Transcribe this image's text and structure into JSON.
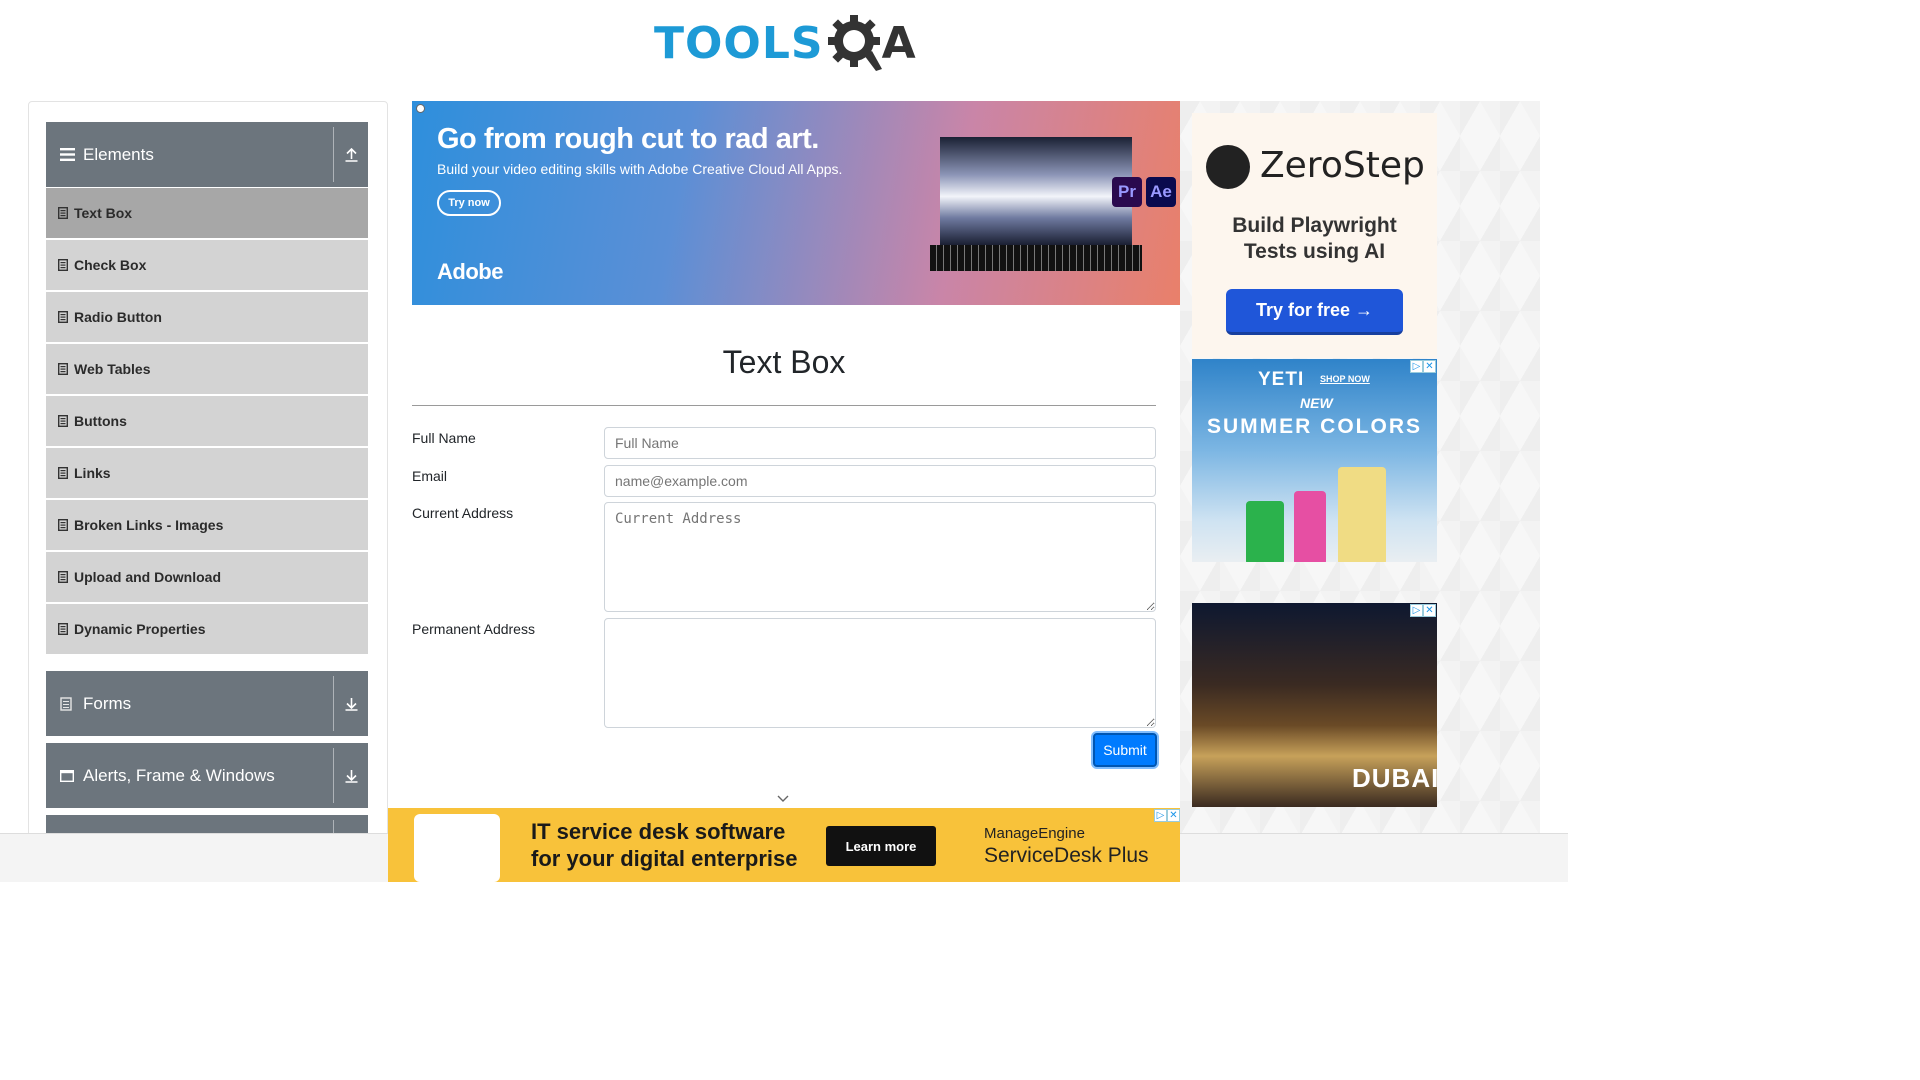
{
  "header": {
    "logo_text_tools": "TOOLS",
    "logo_text_a": "A"
  },
  "sidebar": {
    "groups": [
      {
        "label": "Elements",
        "icon": "hamburger-icon",
        "toggle": "collapse-up-icon"
      },
      {
        "label": "Forms",
        "icon": "document-icon",
        "toggle": "expand-down-icon"
      },
      {
        "label": "Alerts, Frame & Windows",
        "icon": "window-icon",
        "toggle": "expand-down-icon"
      }
    ],
    "items": [
      {
        "label": "Text Box"
      },
      {
        "label": "Check Box"
      },
      {
        "label": "Radio Button"
      },
      {
        "label": "Web Tables"
      },
      {
        "label": "Buttons"
      },
      {
        "label": "Links"
      },
      {
        "label": "Broken Links - Images"
      },
      {
        "label": "Upload and Download"
      },
      {
        "label": "Dynamic Properties"
      }
    ]
  },
  "top_ad": {
    "headline": "Go from rough cut to rad art.",
    "sub": "Build your video editing skills with Adobe Creative Cloud All Apps.",
    "cta": "Try now",
    "brand": "Adobe",
    "badge1": "Pr",
    "badge2": "Ae"
  },
  "main": {
    "title": "Text Box",
    "labels": {
      "full_name": "Full Name",
      "email": "Email",
      "current_address": "Current Address",
      "permanent_address": "Permanent Address"
    },
    "placeholders": {
      "full_name": "Full Name",
      "email": "name@example.com",
      "current_address": "Current Address",
      "permanent_address": ""
    },
    "submit": "Submit"
  },
  "right_ads": {
    "zerostep": {
      "name": "ZeroStep",
      "text_line1": "Build Playwright",
      "text_line2": "Tests using AI",
      "cta": "Try for free →"
    },
    "yeti": {
      "brand": "YETI",
      "shop": "SHOP NOW",
      "new": "NEW",
      "title": "SUMMER COLORS"
    },
    "dubai": {
      "brand": "DUBAI"
    }
  },
  "bottom_ad": {
    "line1": "IT service desk software",
    "line2": "for your digital enterprise",
    "cta": "Learn more",
    "brand1": "ManageEngine",
    "brand2": "ServiceDesk Plus"
  },
  "colors": {
    "accent": "#007bff",
    "sidebar_group": "#6c757d",
    "sidebar_item": "#d3d3d3",
    "sidebar_active": "#a7a7a7"
  }
}
